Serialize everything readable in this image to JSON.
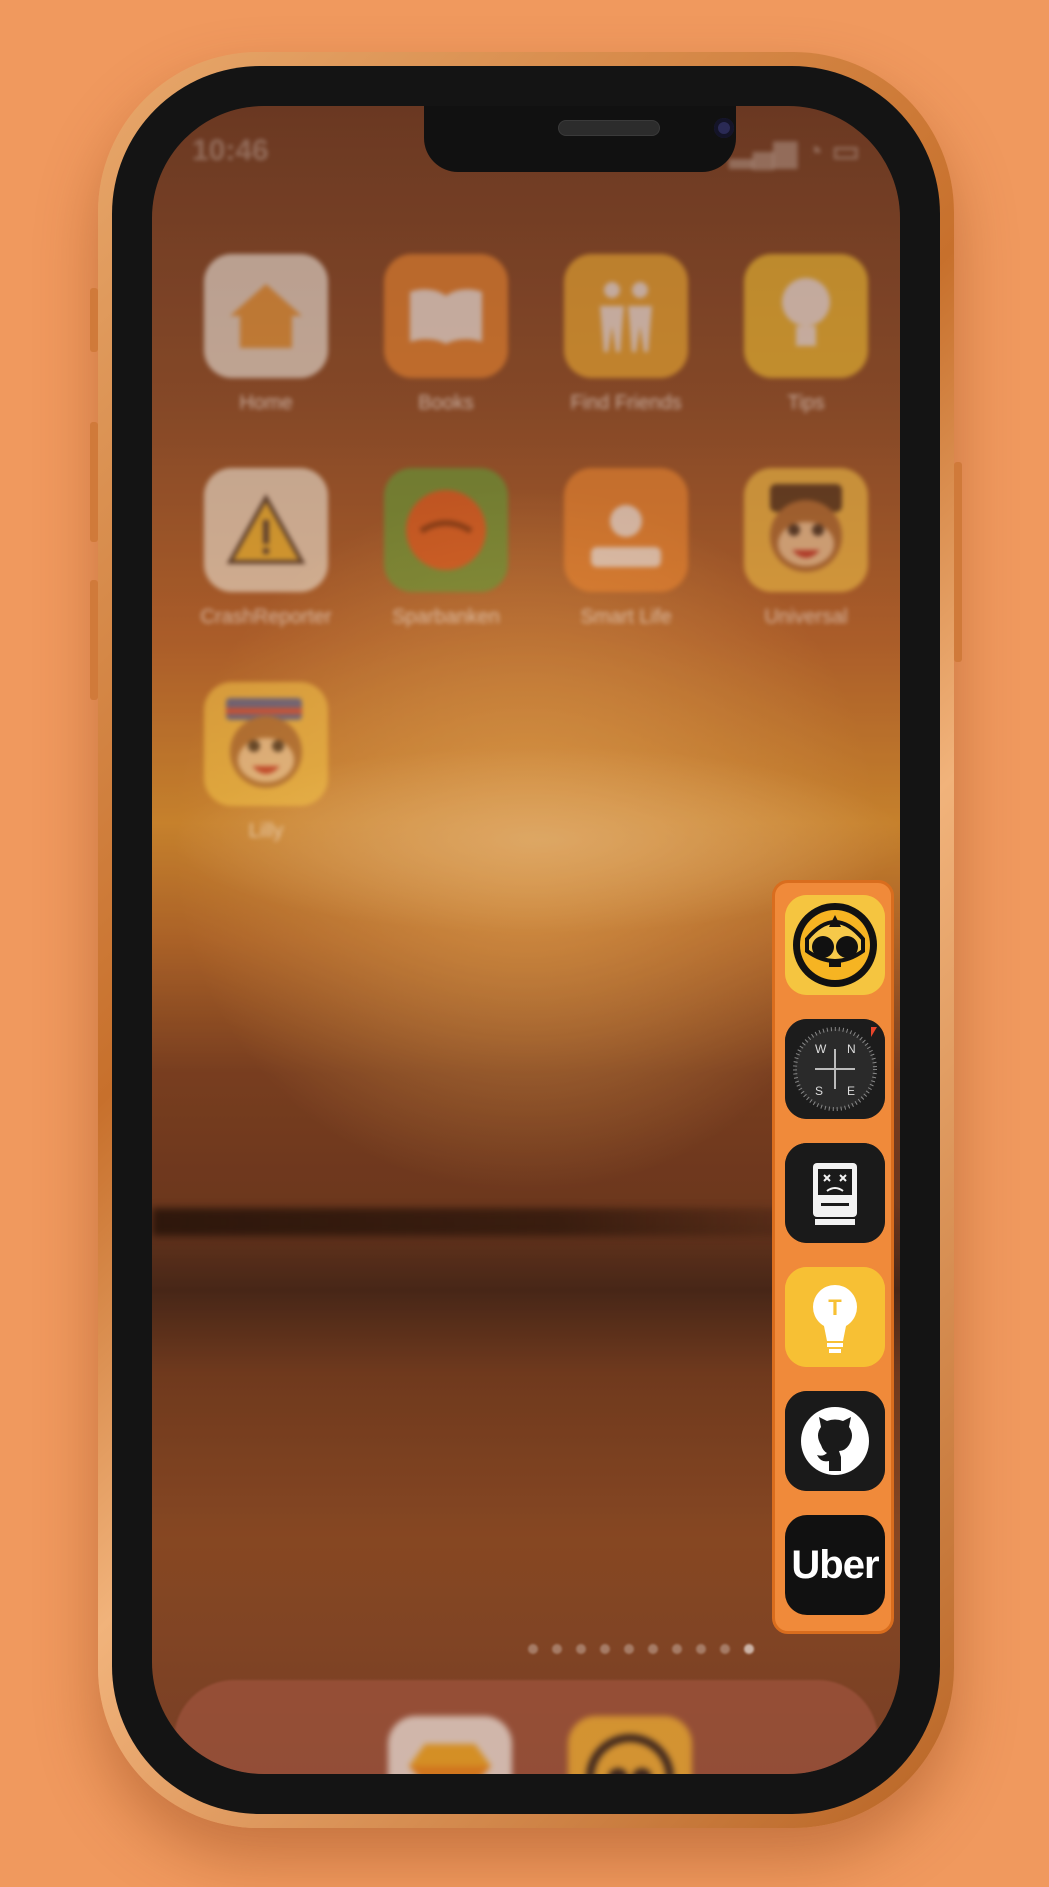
{
  "status_bar": {
    "time": "10:46"
  },
  "grid_apps": [
    {
      "label": "Home",
      "icon": "home-icon",
      "color": "#f1efe9"
    },
    {
      "label": "Books",
      "icon": "book-icon",
      "color": "#f08a32"
    },
    {
      "label": "Find Friends",
      "icon": "find-friends-icon",
      "color": "#f5b434"
    },
    {
      "label": "Tips",
      "icon": "lightbulb-icon",
      "color": "#f7c734"
    },
    {
      "label": "CrashReporter",
      "icon": "warning-icon",
      "color": "#f3efe2"
    },
    {
      "label": "Sparbanken",
      "icon": "bank-icon",
      "color": "#5aa23a"
    },
    {
      "label": "Smart Life",
      "icon": "smart-life-icon",
      "color": "#f08a32"
    },
    {
      "label": "Universal",
      "icon": "monkey-icon",
      "color": "#f5c64a"
    },
    {
      "label": "Lilly",
      "icon": "monkey-flag-icon",
      "color": "#f5c64a"
    }
  ],
  "page_dots": {
    "count": 10,
    "active": 9
  },
  "dock_apps": [
    {
      "icon": "sketch-diamond-icon",
      "color": "#f1efe9"
    },
    {
      "icon": "brawl-skull-icon",
      "color": "#f5b830"
    }
  ],
  "switcher": {
    "apps": [
      {
        "icon": "brawl-skull-icon",
        "color": "#f5b830"
      },
      {
        "icon": "compass-icon",
        "color": "#1c1c1c",
        "letters": [
          "W",
          "N",
          "S",
          "E"
        ]
      },
      {
        "icon": "sad-mac-icon",
        "color": "#1a1a1a"
      },
      {
        "icon": "lightbulb-icon",
        "color": "#f7c034",
        "letter": "T"
      },
      {
        "icon": "github-icon",
        "color": "#1a1a1a"
      },
      {
        "icon": "uber-icon",
        "color": "#111111",
        "text": "Uber"
      }
    ]
  }
}
